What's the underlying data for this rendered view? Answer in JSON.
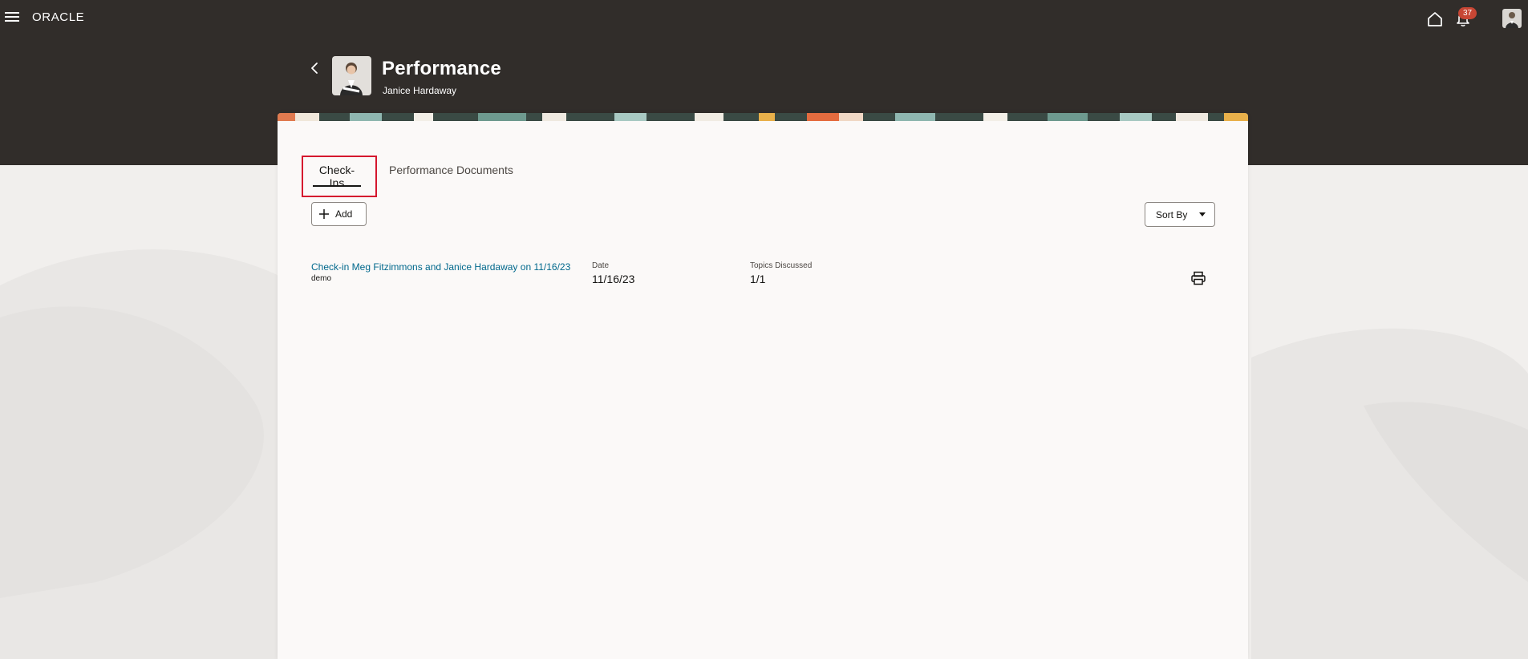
{
  "global_header": {
    "brand": "ORACLE",
    "notification_count": "37",
    "icons": [
      "hamburger-menu-icon",
      "home-icon",
      "bell-icon"
    ]
  },
  "page": {
    "title": "Performance",
    "subtitle": "Janice Hardaway"
  },
  "tabs": [
    {
      "label": "Check-Ins",
      "selected": true
    },
    {
      "label": "Performance Documents",
      "selected": false
    }
  ],
  "toolbar": {
    "add_label": "Add",
    "sort_label": "Sort By"
  },
  "checkins": [
    {
      "title": "Check-in Meg Fitzimmons and Janice Hardaway on 11/16/23",
      "subtitle": "demo",
      "date_label": "Date",
      "date_value": "11/16/23",
      "topics_label": "Topics Discussed",
      "topics_value": "1/1"
    }
  ],
  "colors": {
    "header_bg": "#312d2a",
    "page_bg": "#f1efed",
    "panel_bg": "#fbf9f8",
    "link": "#00688c",
    "badge": "#c74634",
    "focus_outline": "#d5172e"
  }
}
